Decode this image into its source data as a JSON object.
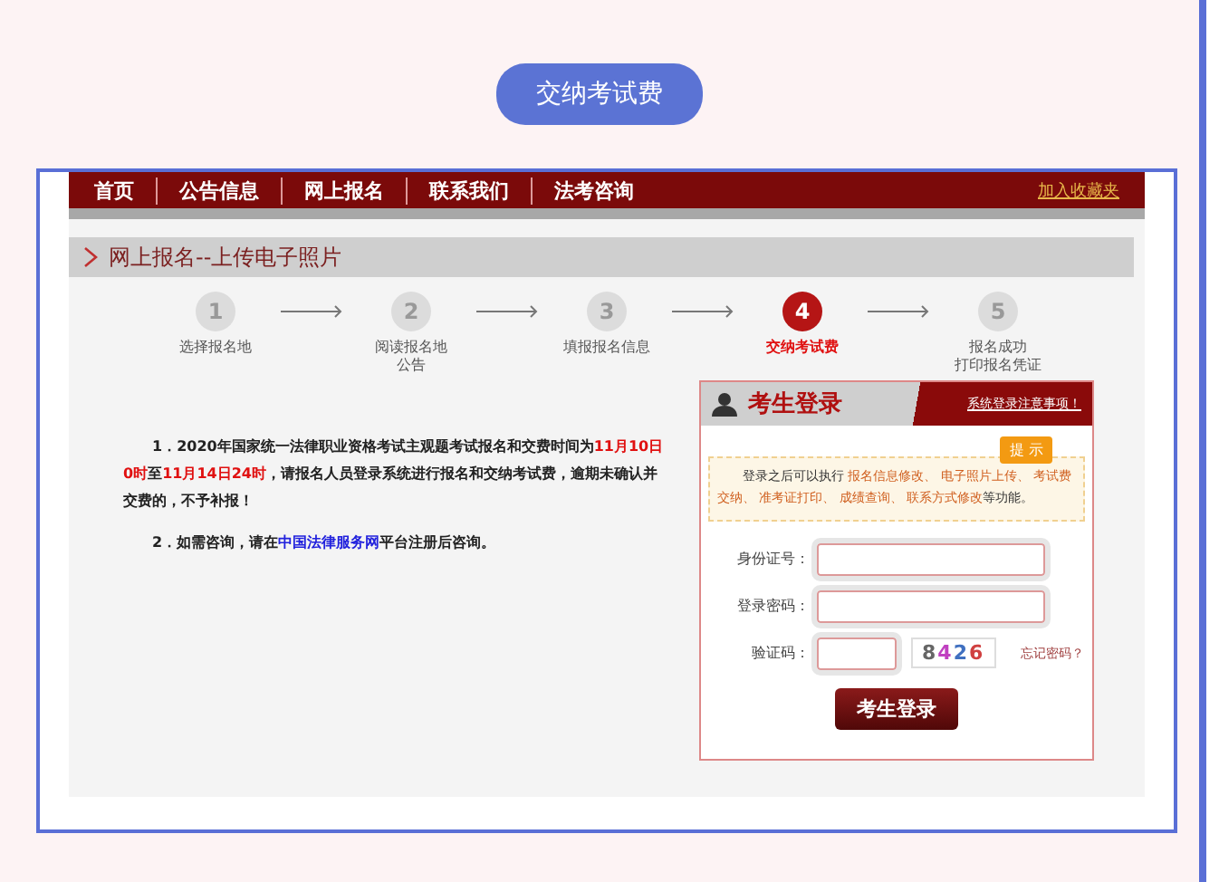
{
  "header_button": "交纳考试费",
  "nav": {
    "items": [
      "首页",
      "公告信息",
      "网上报名",
      "联系我们",
      "法考咨询"
    ],
    "link": "加入收藏夹"
  },
  "section_title": "网上报名--上传电子照片",
  "steps": [
    {
      "number": "1",
      "lines": [
        "选择报名地"
      ],
      "selected": false
    },
    {
      "number": "2",
      "lines": [
        "阅读报名地",
        "公告"
      ],
      "selected": false
    },
    {
      "number": "3",
      "lines": [
        "填报报名信息"
      ],
      "selected": false
    },
    {
      "number": "4",
      "lines": [
        "交纳考试费"
      ],
      "selected": true
    },
    {
      "number": "5",
      "lines": [
        "报名成功",
        "打印报名凭证"
      ],
      "selected": false
    }
  ],
  "notices": [
    {
      "segments": [
        {
          "kind": "plain",
          "text": "1．2020年国家统一法律职业资格考试主观题考试报名和交费时间为"
        },
        {
          "kind": "highlight",
          "text": "11月10日0时"
        },
        {
          "kind": "plain",
          "text": "至"
        },
        {
          "kind": "highlight",
          "text": "11月14日24时"
        },
        {
          "kind": "plain",
          "text": "，请报名人员登录系统进行报名和交纳考试费，逾期未确认并交费的，不予补报！"
        }
      ]
    },
    {
      "segments": [
        {
          "kind": "plain",
          "text": "2．如需咨询，请在"
        },
        {
          "kind": "link",
          "text": "中国法律服务网"
        },
        {
          "kind": "plain",
          "text": "平台注册后咨询。"
        }
      ]
    }
  ],
  "login": {
    "title": "考生登录",
    "notice_link": "系统登录注意事项！",
    "tip_badge": "提 示",
    "tip": [
      {
        "kind": "plain",
        "text": "登录之后可以执行 "
      },
      {
        "kind": "highlight",
        "text": "报名信息修改、 电子照片上传、 考试费交纳、 准考证打印、 成绩查询、 联系方式修改"
      },
      {
        "kind": "plain",
        "text": "等功能。"
      }
    ],
    "fields": [
      {
        "label": "身份证号：",
        "kind": "text"
      },
      {
        "label": "登录密码：",
        "kind": "password"
      },
      {
        "label": "验证码：",
        "kind": "captcha"
      }
    ],
    "captcha": "8426",
    "forgot_link": "忘记密码？",
    "submit": "考生登录"
  }
}
